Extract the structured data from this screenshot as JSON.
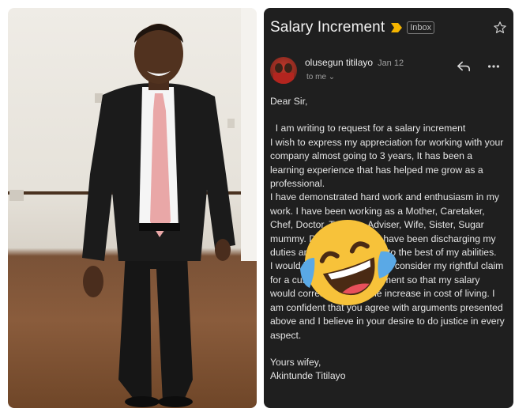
{
  "email": {
    "subject": "Salary Increment",
    "label": "Inbox",
    "sender": "olusegun titilayo",
    "date": "Jan 12",
    "recipients": "to me",
    "greeting": "Dear Sir,",
    "paragraphs": [
      "  I am writing to request for a salary increment",
      "I wish to express my appreciation for working with your company almost going to 3 years, It has been a learning experience that has helped me grow as a professional.",
      "I have demonstrated hard work and enthusiasm in my work. I have been working as a Mother, Caretaker, Chef, Doctor, Teacher, Adviser, Wife, Sister, Sugar mummy. During this time i have been discharging my duties and performed them to the best of my abilities.",
      "I would like to request you to consider my rightful claim for a customary pay adjustment so that my salary would correspond with the increase in cost of living. I am confident that you agree with arguments presented above and I believe in your desire to do justice in every aspect."
    ],
    "closing": "Yours wifey,",
    "signature": "Akintunde Titilayo"
  },
  "icons": {
    "importance": "importance-marker-icon",
    "star": "star-icon",
    "reply": "reply-icon",
    "more": "more-options-icon",
    "emoji": "face-with-tears-of-joy-emoji"
  },
  "colors": {
    "mail_background": "#1f1f1f",
    "importance_marker": "#f4b400",
    "emoji_face": "#f7c23a",
    "emoji_tears": "#5aa9e6"
  }
}
